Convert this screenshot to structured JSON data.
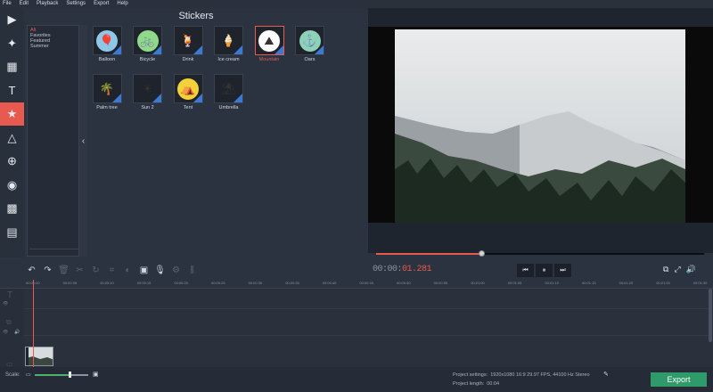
{
  "menu": [
    "File",
    "Edit",
    "Playback",
    "Settings",
    "Export",
    "Help"
  ],
  "left_tools": [
    {
      "icon": "import-icon",
      "active": false
    },
    {
      "icon": "magic-wand-icon",
      "active": false
    },
    {
      "icon": "filters-icon",
      "active": false
    },
    {
      "icon": "titles-icon",
      "active": false
    },
    {
      "icon": "stickers-icon",
      "active": true
    },
    {
      "icon": "transitions-icon",
      "active": false
    },
    {
      "icon": "zoom-icon",
      "active": false
    },
    {
      "icon": "stabilization-icon",
      "active": false
    },
    {
      "icon": "highlight-icon",
      "active": false
    },
    {
      "icon": "more-tools-icon",
      "active": false
    }
  ],
  "panel": {
    "title": "Stickers"
  },
  "categories": [
    {
      "label": "All",
      "selected": true
    },
    {
      "label": "Favorites",
      "selected": false
    },
    {
      "label": "Featured",
      "selected": false
    },
    {
      "label": "Summer",
      "selected": false
    }
  ],
  "stickers": [
    {
      "label": "Balloon",
      "icon": "balloon-icon",
      "bg": "#8fc7e8",
      "selected": false
    },
    {
      "label": "Bicycle",
      "icon": "bicycle-icon",
      "bg": "#8fd98a",
      "selected": false
    },
    {
      "label": "Drink",
      "icon": "drink-icon",
      "bg": "#1e232c",
      "selected": false
    },
    {
      "label": "Ice cream",
      "icon": "ice-cream-icon",
      "bg": "#1e232c",
      "selected": false
    },
    {
      "label": "Mountain",
      "icon": "mountain-icon",
      "bg": "#ffffff",
      "selected": true
    },
    {
      "label": "Oars",
      "icon": "oars-icon",
      "bg": "#8fd0b8",
      "selected": false
    },
    {
      "label": "Palm tree",
      "icon": "palm-tree-icon",
      "bg": "#1e232c",
      "selected": false
    },
    {
      "label": "Sun 2",
      "icon": "sun-icon",
      "bg": "#1e232c",
      "selected": false
    },
    {
      "label": "Tent",
      "icon": "tent-icon",
      "bg": "#f2d13a",
      "selected": false
    },
    {
      "label": "Umbrella",
      "icon": "umbrella-icon",
      "bg": "#1e232c",
      "selected": false
    }
  ],
  "player": {
    "time_main": "00:00:",
    "time_ms": "01.281",
    "progress": 0.32
  },
  "ruler": [
    "00:00:00",
    "00:00:05",
    "00:00:10",
    "00:00:15",
    "00:00:20",
    "00:00:25",
    "00:00:30",
    "00:00:35",
    "00:00:40",
    "00:00:45",
    "00:00:50",
    "00:00:55",
    "00:01:00",
    "00:01:05",
    "00:01:10",
    "00:01:15",
    "00:01:20",
    "00:01:25",
    "00:01:30"
  ],
  "status": {
    "scale_label": "Scale:",
    "scale_value": 0.65,
    "project_settings_label": "Project settings:",
    "project_settings_value": "1920x1080 16:9 29.97 FPS, 44100 Hz Stereo",
    "project_length_label": "Project length:",
    "project_length_value": "00:04",
    "export_label": "Export"
  },
  "colors": {
    "accent": "#e85a4f",
    "export": "#2f9a6a",
    "sticker_corner": "#3b7ad0"
  }
}
